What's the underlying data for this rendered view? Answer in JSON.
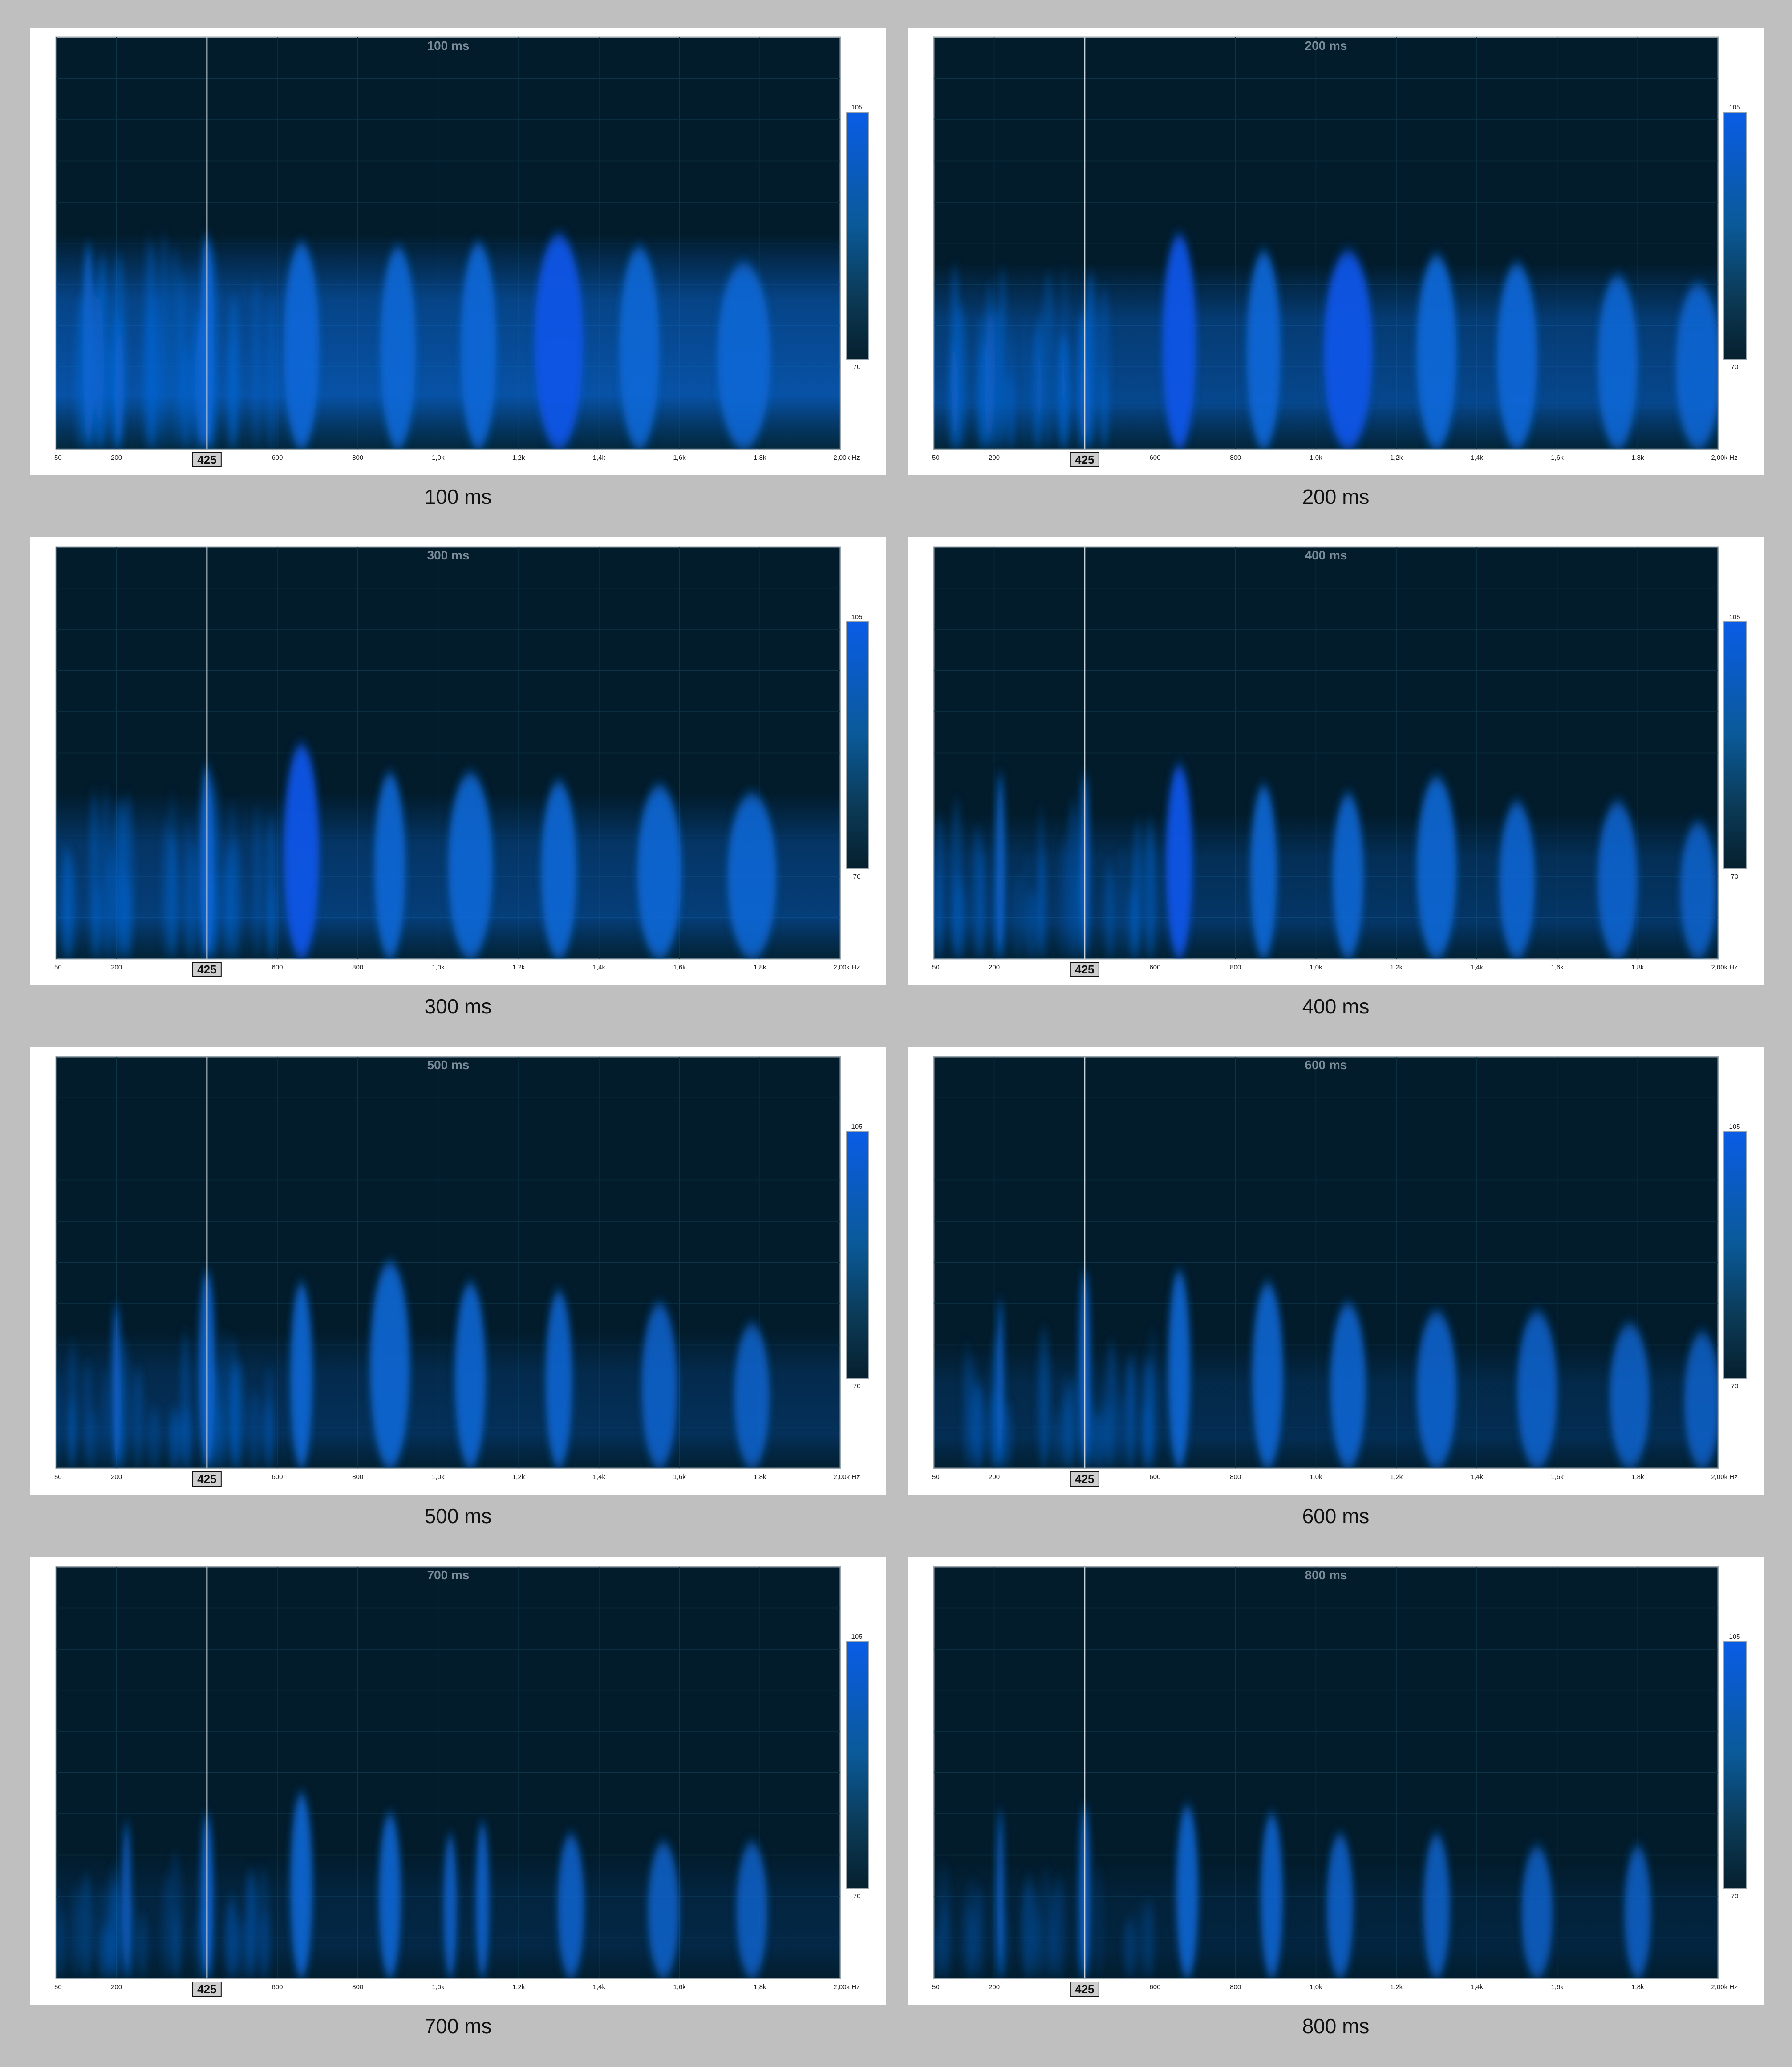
{
  "colors": {
    "background": "#bfbfbf",
    "panel": "#ffffff",
    "plot_bg": "#021c2c",
    "grid": "#0c3346",
    "energy": "#0a68d8",
    "energy_peak": "#0a55e6",
    "scale_top": "#0a5ce6",
    "scale_bottom": "#06202e",
    "title_text": "#7c8c98",
    "cursor": "#c8d2da",
    "marker_bg": "#cfcfcf"
  },
  "chart_data": [
    {
      "type": "heatmap",
      "title": "100 ms",
      "caption": "100 ms",
      "xlim": [
        50,
        2000
      ],
      "x_ticks": [
        "50",
        "200",
        "600",
        "800",
        "1,0k",
        "1,2k",
        "1,4k",
        "1,6k",
        "1,8k",
        "2,00k Hz"
      ],
      "x_tick_values": [
        50,
        200,
        600,
        800,
        1000,
        1200,
        1400,
        1600,
        1800,
        2000
      ],
      "cursor_label": "425",
      "cursor_value": 425,
      "color_scale": {
        "max_label": "105",
        "min_label": "70",
        "min": 70,
        "max": 105
      },
      "energy_top": 0.52,
      "energy_strength": 0.95,
      "peaks": [
        {
          "x": 130,
          "h": 0.5,
          "w": 12,
          "s": 0.8
        },
        {
          "x": 425,
          "h": 0.52,
          "w": 16,
          "s": 0.9
        },
        {
          "x": 660,
          "h": 0.5,
          "w": 40,
          "s": 0.9
        },
        {
          "x": 900,
          "h": 0.49,
          "w": 40,
          "s": 0.85
        },
        {
          "x": 1100,
          "h": 0.5,
          "w": 40,
          "s": 0.9
        },
        {
          "x": 1300,
          "h": 0.52,
          "w": 55,
          "s": 1.0
        },
        {
          "x": 1500,
          "h": 0.49,
          "w": 45,
          "s": 0.85
        },
        {
          "x": 1760,
          "h": 0.45,
          "w": 60,
          "s": 0.8
        }
      ]
    },
    {
      "type": "heatmap",
      "title": "200 ms",
      "caption": "200 ms",
      "xlim": [
        50,
        2000
      ],
      "x_ticks": [
        "50",
        "200",
        "600",
        "800",
        "1,0k",
        "1,2k",
        "1,4k",
        "1,6k",
        "1,8k",
        "2,00k Hz"
      ],
      "x_tick_values": [
        50,
        200,
        600,
        800,
        1000,
        1200,
        1400,
        1600,
        1800,
        2000
      ],
      "cursor_label": "425",
      "cursor_value": 425,
      "color_scale": {
        "max_label": "105",
        "min_label": "70",
        "min": 70,
        "max": 105
      },
      "energy_top": 0.45,
      "energy_strength": 0.75,
      "peaks": [
        {
          "x": 660,
          "h": 0.52,
          "w": 38,
          "s": 1.0
        },
        {
          "x": 870,
          "h": 0.48,
          "w": 38,
          "s": 0.9
        },
        {
          "x": 1080,
          "h": 0.48,
          "w": 55,
          "s": 1.0
        },
        {
          "x": 1300,
          "h": 0.47,
          "w": 45,
          "s": 0.95
        },
        {
          "x": 1500,
          "h": 0.45,
          "w": 45,
          "s": 0.9
        },
        {
          "x": 1750,
          "h": 0.42,
          "w": 45,
          "s": 0.8
        },
        {
          "x": 1950,
          "h": 0.4,
          "w": 50,
          "s": 0.75
        }
      ]
    },
    {
      "type": "heatmap",
      "title": "300 ms",
      "caption": "300 ms",
      "xlim": [
        50,
        2000
      ],
      "x_ticks": [
        "50",
        "200",
        "600",
        "800",
        "1,0k",
        "1,2k",
        "1,4k",
        "1,6k",
        "1,8k",
        "2,00k Hz"
      ],
      "x_tick_values": [
        50,
        200,
        600,
        800,
        1000,
        1200,
        1400,
        1600,
        1800,
        2000
      ],
      "cursor_label": "425",
      "cursor_value": 425,
      "color_scale": {
        "max_label": "105",
        "min_label": "70",
        "min": 70,
        "max": 105
      },
      "energy_top": 0.4,
      "energy_strength": 0.6,
      "peaks": [
        {
          "x": 425,
          "h": 0.47,
          "w": 16,
          "s": 0.8
        },
        {
          "x": 660,
          "h": 0.52,
          "w": 40,
          "s": 1.0
        },
        {
          "x": 880,
          "h": 0.45,
          "w": 35,
          "s": 0.85
        },
        {
          "x": 1080,
          "h": 0.45,
          "w": 50,
          "s": 0.85
        },
        {
          "x": 1300,
          "h": 0.43,
          "w": 40,
          "s": 0.85
        },
        {
          "x": 1550,
          "h": 0.42,
          "w": 50,
          "s": 0.85
        },
        {
          "x": 1780,
          "h": 0.4,
          "w": 55,
          "s": 0.8
        }
      ]
    },
    {
      "type": "heatmap",
      "title": "400 ms",
      "caption": "400 ms",
      "xlim": [
        50,
        2000
      ],
      "x_ticks": [
        "50",
        "200",
        "600",
        "800",
        "1,0k",
        "1,2k",
        "1,4k",
        "1,6k",
        "1,8k",
        "2,00k Hz"
      ],
      "x_tick_values": [
        50,
        200,
        600,
        800,
        1000,
        1200,
        1400,
        1600,
        1800,
        2000
      ],
      "cursor_label": "425",
      "cursor_value": 425,
      "color_scale": {
        "max_label": "105",
        "min_label": "70",
        "min": 70,
        "max": 105
      },
      "energy_top": 0.35,
      "energy_strength": 0.45,
      "peaks": [
        {
          "x": 215,
          "h": 0.45,
          "w": 10,
          "s": 0.85
        },
        {
          "x": 425,
          "h": 0.45,
          "w": 10,
          "s": 0.8
        },
        {
          "x": 660,
          "h": 0.47,
          "w": 30,
          "s": 1.0
        },
        {
          "x": 870,
          "h": 0.42,
          "w": 30,
          "s": 0.85
        },
        {
          "x": 1080,
          "h": 0.4,
          "w": 35,
          "s": 0.8
        },
        {
          "x": 1300,
          "h": 0.44,
          "w": 45,
          "s": 0.85
        },
        {
          "x": 1500,
          "h": 0.38,
          "w": 40,
          "s": 0.75
        },
        {
          "x": 1750,
          "h": 0.38,
          "w": 45,
          "s": 0.7
        },
        {
          "x": 1950,
          "h": 0.33,
          "w": 40,
          "s": 0.6
        }
      ]
    },
    {
      "type": "heatmap",
      "title": "500 ms",
      "caption": "500 ms",
      "xlim": [
        50,
        2000
      ],
      "x_ticks": [
        "50",
        "200",
        "600",
        "800",
        "1,0k",
        "1,2k",
        "1,4k",
        "1,6k",
        "1,8k",
        "2,00k Hz"
      ],
      "x_tick_values": [
        50,
        200,
        600,
        800,
        1000,
        1200,
        1400,
        1600,
        1800,
        2000
      ],
      "cursor_label": "425",
      "cursor_value": 425,
      "color_scale": {
        "max_label": "105",
        "min_label": "70",
        "min": 70,
        "max": 105
      },
      "energy_top": 0.33,
      "energy_strength": 0.35,
      "peaks": [
        {
          "x": 200,
          "h": 0.4,
          "w": 10,
          "s": 0.7
        },
        {
          "x": 425,
          "h": 0.48,
          "w": 18,
          "s": 0.8
        },
        {
          "x": 660,
          "h": 0.45,
          "w": 25,
          "s": 0.85
        },
        {
          "x": 880,
          "h": 0.5,
          "w": 45,
          "s": 0.85
        },
        {
          "x": 1080,
          "h": 0.45,
          "w": 35,
          "s": 0.8
        },
        {
          "x": 1300,
          "h": 0.43,
          "w": 30,
          "s": 0.75
        },
        {
          "x": 1550,
          "h": 0.4,
          "w": 40,
          "s": 0.65
        },
        {
          "x": 1780,
          "h": 0.35,
          "w": 40,
          "s": 0.6
        }
      ]
    },
    {
      "type": "heatmap",
      "title": "600 ms",
      "caption": "600 ms",
      "xlim": [
        50,
        2000
      ],
      "x_ticks": [
        "50",
        "200",
        "600",
        "800",
        "1,0k",
        "1,2k",
        "1,4k",
        "1,6k",
        "1,8k",
        "2,00k Hz"
      ],
      "x_tick_values": [
        50,
        200,
        600,
        800,
        1000,
        1200,
        1400,
        1600,
        1800,
        2000
      ],
      "cursor_label": "425",
      "cursor_value": 425,
      "color_scale": {
        "max_label": "105",
        "min_label": "70",
        "min": 70,
        "max": 105
      },
      "energy_top": 0.3,
      "energy_strength": 0.3,
      "peaks": [
        {
          "x": 215,
          "h": 0.41,
          "w": 8,
          "s": 0.75
        },
        {
          "x": 425,
          "h": 0.48,
          "w": 12,
          "s": 0.9
        },
        {
          "x": 660,
          "h": 0.48,
          "w": 25,
          "s": 0.85
        },
        {
          "x": 880,
          "h": 0.45,
          "w": 35,
          "s": 0.8
        },
        {
          "x": 1080,
          "h": 0.4,
          "w": 40,
          "s": 0.75
        },
        {
          "x": 1300,
          "h": 0.38,
          "w": 45,
          "s": 0.7
        },
        {
          "x": 1550,
          "h": 0.38,
          "w": 45,
          "s": 0.65
        },
        {
          "x": 1780,
          "h": 0.35,
          "w": 45,
          "s": 0.6
        },
        {
          "x": 1960,
          "h": 0.33,
          "w": 40,
          "s": 0.55
        }
      ]
    },
    {
      "type": "heatmap",
      "title": "700 ms",
      "caption": "700 ms",
      "xlim": [
        50,
        2000
      ],
      "x_ticks": [
        "50",
        "200",
        "600",
        "800",
        "1,0k",
        "1,2k",
        "1,4k",
        "1,6k",
        "1,8k",
        "2,00k Hz"
      ],
      "x_tick_values": [
        50,
        200,
        600,
        800,
        1000,
        1200,
        1400,
        1600,
        1800,
        2000
      ],
      "cursor_label": "425",
      "cursor_value": 425,
      "color_scale": {
        "max_label": "105",
        "min_label": "70",
        "min": 70,
        "max": 105
      },
      "energy_top": 0.3,
      "energy_strength": 0.2,
      "peaks": [
        {
          "x": 225,
          "h": 0.38,
          "w": 10,
          "s": 0.7
        },
        {
          "x": 425,
          "h": 0.4,
          "w": 14,
          "s": 0.8
        },
        {
          "x": 660,
          "h": 0.45,
          "w": 25,
          "s": 0.85
        },
        {
          "x": 880,
          "h": 0.4,
          "w": 25,
          "s": 0.8
        },
        {
          "x": 1030,
          "h": 0.35,
          "w": 15,
          "s": 0.7
        },
        {
          "x": 1110,
          "h": 0.38,
          "w": 15,
          "s": 0.75
        },
        {
          "x": 1330,
          "h": 0.35,
          "w": 30,
          "s": 0.65
        },
        {
          "x": 1560,
          "h": 0.33,
          "w": 35,
          "s": 0.6
        },
        {
          "x": 1780,
          "h": 0.33,
          "w": 35,
          "s": 0.55
        }
      ]
    },
    {
      "type": "heatmap",
      "title": "800 ms",
      "caption": "800 ms",
      "xlim": [
        50,
        2000
      ],
      "x_ticks": [
        "50",
        "200",
        "600",
        "800",
        "1,0k",
        "1,2k",
        "1,4k",
        "1,6k",
        "1,8k",
        "2,00k Hz"
      ],
      "x_tick_values": [
        50,
        200,
        600,
        800,
        1000,
        1200,
        1400,
        1600,
        1800,
        2000
      ],
      "cursor_label": "425",
      "cursor_value": 425,
      "color_scale": {
        "max_label": "105",
        "min_label": "70",
        "min": 70,
        "max": 105
      },
      "energy_top": 0.28,
      "energy_strength": 0.15,
      "peaks": [
        {
          "x": 215,
          "h": 0.41,
          "w": 8,
          "s": 0.75
        },
        {
          "x": 425,
          "h": 0.42,
          "w": 12,
          "s": 0.8
        },
        {
          "x": 680,
          "h": 0.42,
          "w": 25,
          "s": 0.8
        },
        {
          "x": 890,
          "h": 0.4,
          "w": 25,
          "s": 0.75
        },
        {
          "x": 1060,
          "h": 0.35,
          "w": 30,
          "s": 0.65
        },
        {
          "x": 1300,
          "h": 0.35,
          "w": 30,
          "s": 0.6
        },
        {
          "x": 1550,
          "h": 0.32,
          "w": 35,
          "s": 0.55
        },
        {
          "x": 1800,
          "h": 0.32,
          "w": 30,
          "s": 0.55
        }
      ]
    }
  ]
}
